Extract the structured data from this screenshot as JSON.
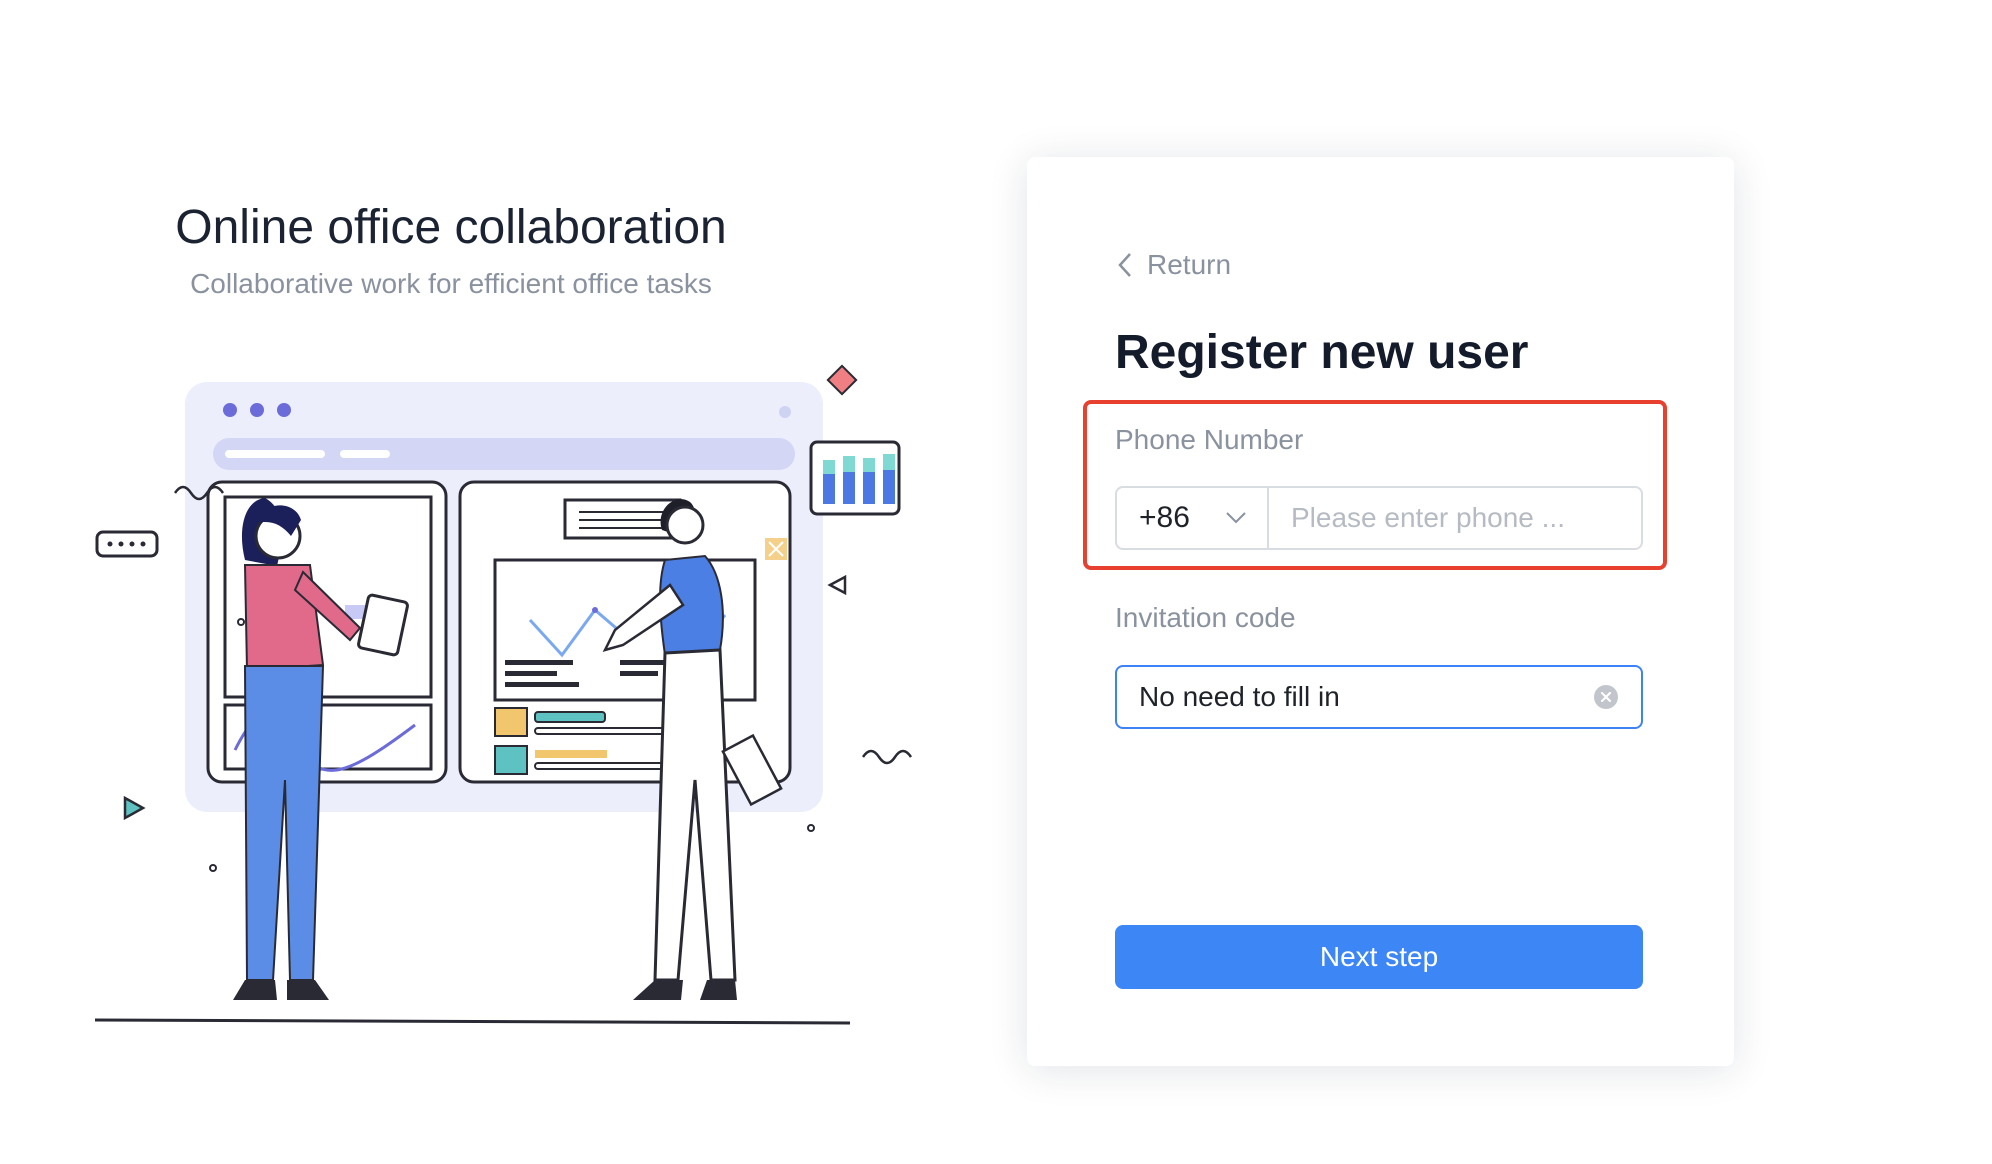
{
  "hero": {
    "title": "Online office collaboration",
    "subtitle": "Collaborative work for efficient office tasks"
  },
  "form": {
    "back_label": "Return",
    "title": "Register new user",
    "phone": {
      "label": "Phone Number",
      "country_code": "+86",
      "placeholder": "Please enter phone ...",
      "value": ""
    },
    "invitation": {
      "label": "Invitation code",
      "value": "No need to fill in"
    },
    "submit_label": "Next step"
  },
  "colors": {
    "primary": "#3d86f5",
    "highlight_border": "#e8402f",
    "focus_border": "#3d82f6"
  }
}
